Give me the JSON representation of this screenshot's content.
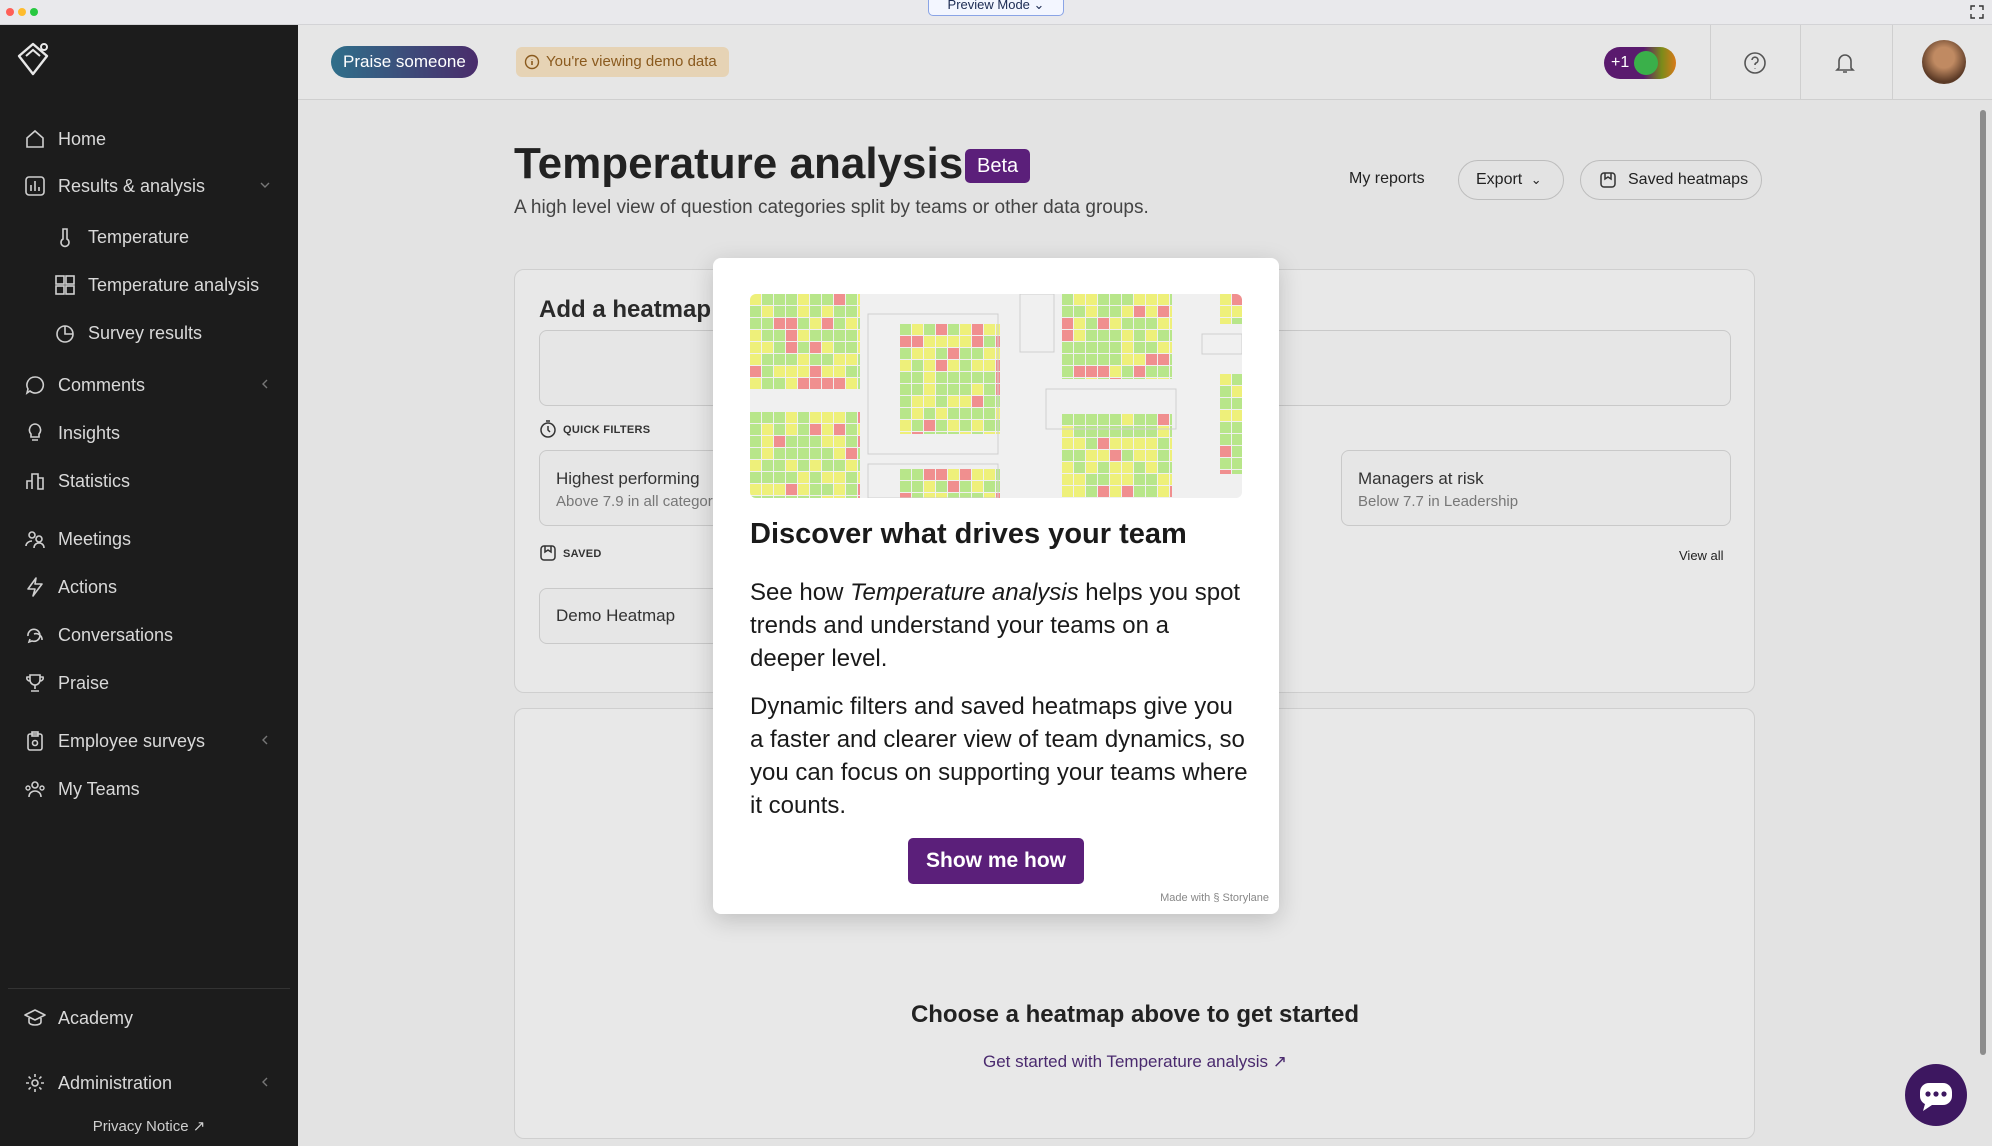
{
  "window": {
    "preview_mode_label": "Preview Mode",
    "traffic_colors": [
      "#ff5f57",
      "#febc2e",
      "#28c840"
    ]
  },
  "sidebar": {
    "items": [
      {
        "label": "Home",
        "icon": "home-icon"
      },
      {
        "label": "Results & analysis",
        "icon": "bar-chart-icon",
        "expanded": true
      },
      {
        "label": "Temperature",
        "icon": "thermometer-icon"
      },
      {
        "label": "Temperature analysis",
        "icon": "grid-icon"
      },
      {
        "label": "Survey results",
        "icon": "pie-chart-icon"
      },
      {
        "label": "Comments",
        "icon": "comment-icon"
      },
      {
        "label": "Insights",
        "icon": "lightbulb-icon"
      },
      {
        "label": "Statistics",
        "icon": "statistics-icon"
      },
      {
        "label": "Meetings",
        "icon": "meetings-icon"
      },
      {
        "label": "Actions",
        "icon": "lightning-icon"
      },
      {
        "label": "Conversations",
        "icon": "conversations-icon"
      },
      {
        "label": "Praise",
        "icon": "trophy-icon"
      },
      {
        "label": "Employee surveys",
        "icon": "clipboard-icon"
      },
      {
        "label": "My Teams",
        "icon": "team-icon"
      }
    ],
    "bottom": [
      {
        "label": "Academy",
        "icon": "graduation-cap-icon"
      },
      {
        "label": "Administration",
        "icon": "gear-icon"
      }
    ],
    "privacy_notice": "Privacy Notice"
  },
  "topbar": {
    "praise_button": "Praise someone",
    "demo_notice": "You're viewing demo data",
    "points_label": "+1"
  },
  "page": {
    "title": "Temperature analysis",
    "beta_badge": "Beta",
    "subtitle": "A high level view of question categories split by teams or other data groups.",
    "my_reports": "My reports",
    "export": "Export",
    "saved_heatmaps": "Saved heatmaps"
  },
  "add_heatmap": {
    "title": "Add a heatmap",
    "quick_filters_label": "QUICK FILTERS",
    "filters": [
      {
        "title": "Highest performing",
        "subtitle": "Above 7.9 in all categories"
      },
      {
        "title": "Managers at risk",
        "subtitle": "Below 7.7 in Leadership"
      }
    ],
    "saved_label": "SAVED",
    "view_all": "View all",
    "saved_items": [
      "Demo Heatmap"
    ]
  },
  "empty_state": {
    "title": "Choose a heatmap above to get started",
    "link": "Get started with Temperature analysis"
  },
  "modal": {
    "heading": "Discover what drives your team",
    "p1_prefix": "See how ",
    "p1_em": "Temperature analysis",
    "p1_suffix": " helps you spot trends and understand your teams on a deeper level.",
    "p2": "Dynamic filters and saved heatmaps give you a faster and clearer view of team dynamics, so you can focus on supporting your teams where it counts.",
    "cta": "Show me how",
    "made_with": "Made with",
    "made_with_brand": "Storylane"
  },
  "colors": {
    "brand_purple": "#5b1f7a",
    "sidebar_bg": "#1c1c1c",
    "heat_green": "#b8e68a",
    "heat_yellow": "#eef07a",
    "heat_red": "#f08f8f"
  }
}
